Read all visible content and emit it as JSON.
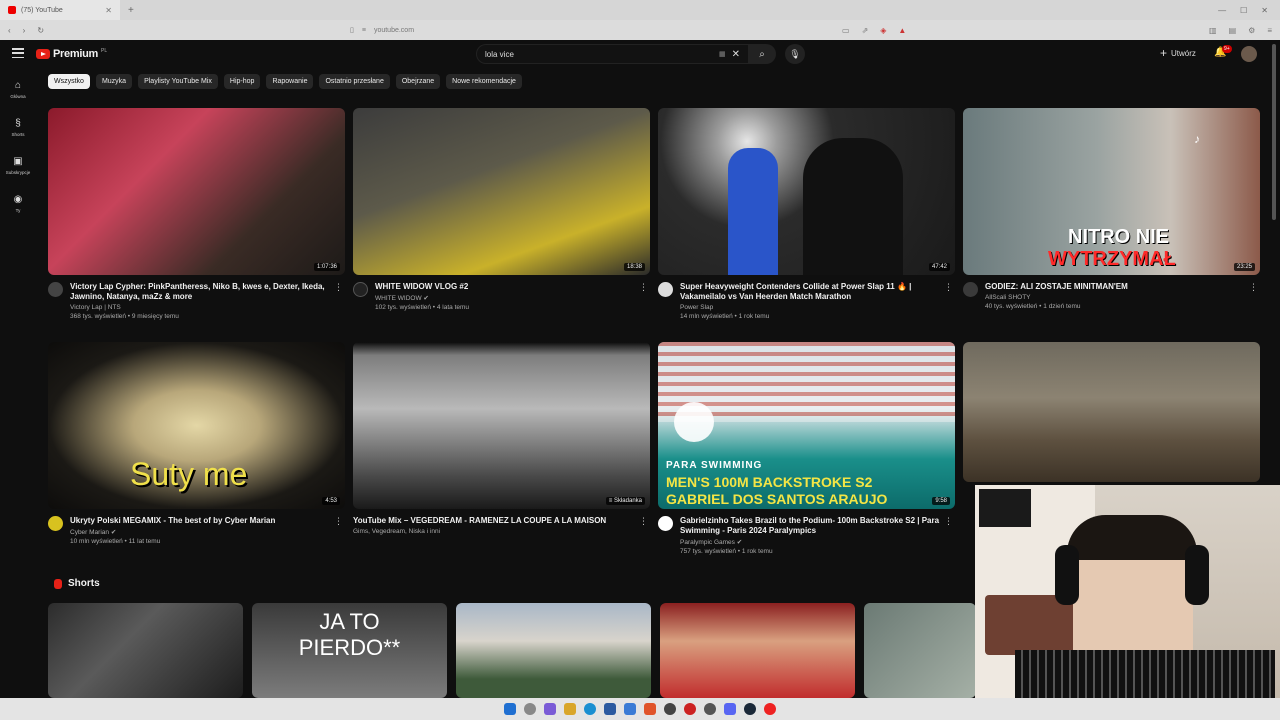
{
  "browser": {
    "tab_title": "(75) YouTube",
    "url": "youtube.com"
  },
  "header": {
    "logo_text": "Premium",
    "region": "PL",
    "search_value": "lola vice",
    "create_label": "Utwórz",
    "notif_count": "9+"
  },
  "sidebar": {
    "items": [
      {
        "label": "Główna",
        "icon": "home-icon"
      },
      {
        "label": "Shorts",
        "icon": "shorts-icon"
      },
      {
        "label": "Subskrypcje",
        "icon": "subscriptions-icon"
      },
      {
        "label": "Ty",
        "icon": "you-icon"
      }
    ]
  },
  "chips": [
    "Wszystko",
    "Muzyka",
    "Playlisty YouTube Mix",
    "Hip-hop",
    "Rapowanie",
    "Ostatnio przesłane",
    "Obejrzane",
    "Nowe rekomendacje"
  ],
  "videos": [
    {
      "title": "Victory Lap Cypher: PinkPantheress, Niko B, kwes e, Dexter, Ikeda, Jawnino, Natanya, maZz & more",
      "channel": "Victory Lap | NTS",
      "stats": "368 tys. wyświetleń • 9 miesięcy temu",
      "duration": "1:07:36"
    },
    {
      "title": "WHITE WIDOW VLOG #2",
      "channel": "WHITE WIDOW",
      "stats": "102 tys. wyświetleń • 4 lata temu",
      "duration": "18:38"
    },
    {
      "title": "Super Heavyweight Contenders Collide at Power Slap 11 🔥 | Vakameilalo vs  Van Heerden Match Marathon",
      "channel": "Power Slap",
      "stats": "14 mln wyświetleń • 1 rok temu",
      "duration": "47:42"
    },
    {
      "title": "GODIEZ: ALI ZOSTAJE MINITMAN'EM",
      "channel": "AllScali SHOTY",
      "stats": "40 tys. wyświetleń • 1 dzień temu",
      "duration": "23:25"
    },
    {
      "title": "Ukryty Polski MEGAMIX - The best of by Cyber Marian",
      "channel": "Cyber Marian",
      "stats": "10 mln wyświetleń • 11 lat temu",
      "duration": "4:53"
    },
    {
      "title": "YouTube Mix – VEGEDREAM - RAMENEZ LA COUPE A LA MAISON",
      "channel": "Gims, Vegedream, Niska i inni",
      "stats": "",
      "duration": "Składanka"
    },
    {
      "title": "Gabrielzinho Takes Brazil to the Podium- 100m Backstroke S2 | Para Swimming - Paris 2024 Paralympics",
      "channel": "Paralympic Games",
      "stats": "757 tys. wyświetleń • 1 rok temu",
      "duration": "9:58"
    }
  ],
  "thumb_text": {
    "v4_line1": "NITRO NIE",
    "v4_line2": "WYTRZYMAŁ",
    "v5": "Suty me",
    "v7_line1": "PARA SWIMMING",
    "v7_line2": "MEN'S 100M BACKSTROKE S2",
    "v7_line3": "GABRIEL DOS SANTOS ARAUJO",
    "short2_line1": "JA TO",
    "short2_line2": "PIERDO**"
  },
  "shorts": {
    "label": "Shorts"
  }
}
